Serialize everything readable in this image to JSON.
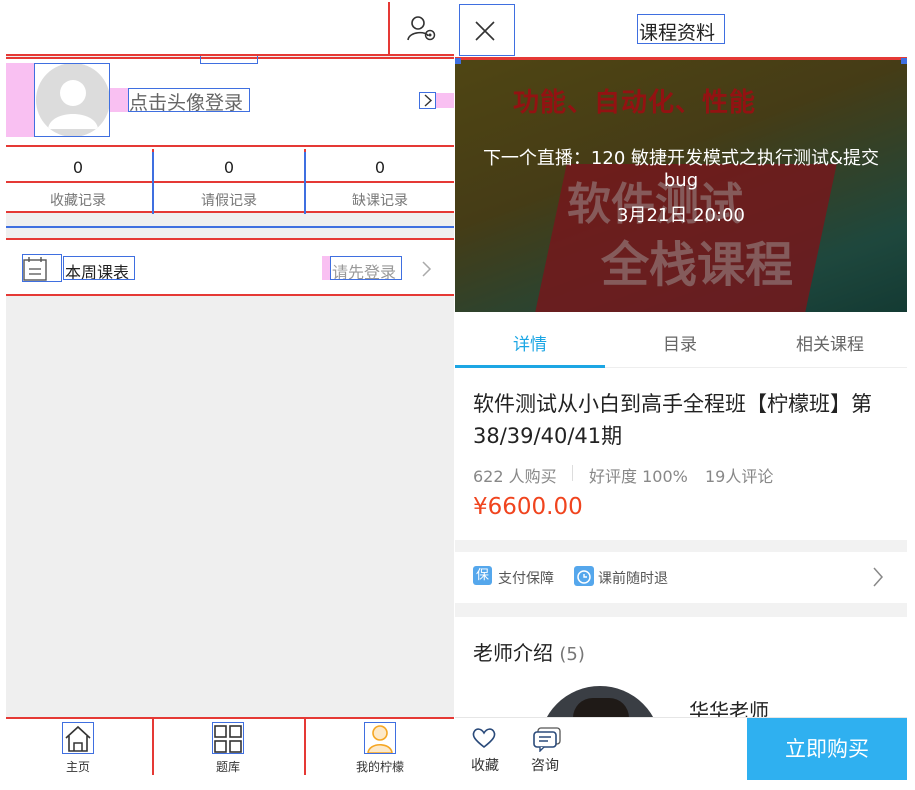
{
  "left": {
    "login_hint": "点击头像登录",
    "stats": [
      {
        "value": "0",
        "label": "收藏记录"
      },
      {
        "value": "0",
        "label": "请假记录"
      },
      {
        "value": "0",
        "label": "缺课记录"
      }
    ],
    "week_title": "本周课表",
    "login_first": "请先登录",
    "tabbar": [
      {
        "label": "主页",
        "icon": "home-icon"
      },
      {
        "label": "题库",
        "icon": "grid-icon"
      },
      {
        "label": "我的柠檬",
        "icon": "person-icon"
      }
    ]
  },
  "right": {
    "title": "课程资料",
    "banner": {
      "headline": "功能、自动化、性能",
      "big_line1": "软件测试",
      "big_line2": "全栈课程",
      "live_text": "下一个直播：120 敏捷开发模式之执行测试&提交bug",
      "live_date": "3月21日 20:00"
    },
    "tabs": [
      "详情",
      "目录",
      "相关课程"
    ],
    "active_tab": 0,
    "course_title": "软件测试从小白到高手全程班【柠檬班】第38/39/40/41期",
    "buyers": "622 人购买",
    "rating": "好评度 100%",
    "reviews": "19人评论",
    "price": "¥6600.00",
    "promise1_badge": "保",
    "promise1": "支付保障",
    "promise2": "课前随时退",
    "teacher_heading": "老师介绍",
    "teacher_count": "(5)",
    "teacher_name": "华华老师",
    "bottom": {
      "favorite": "收藏",
      "consult": "咨询",
      "buy": "立即购买"
    },
    "accent": "#1ca6e4",
    "price_color": "#f0441e"
  }
}
